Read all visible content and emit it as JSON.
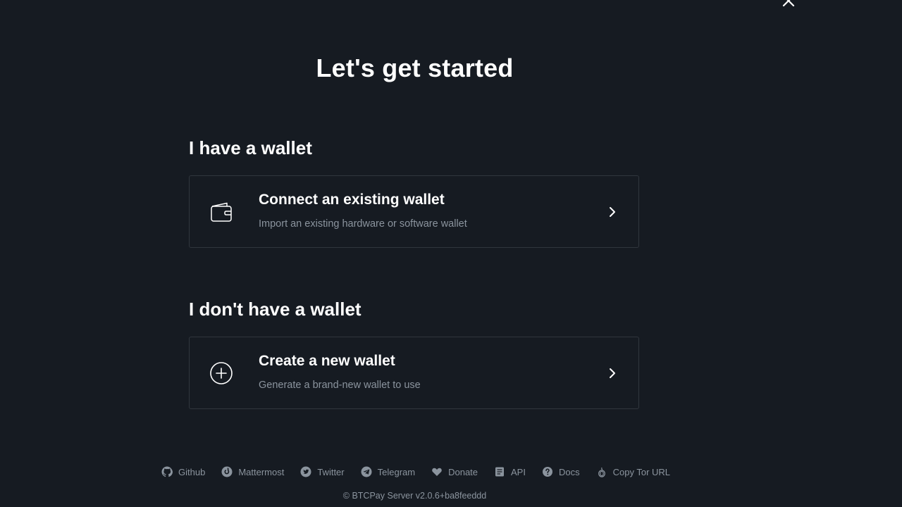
{
  "header": {
    "title": "Let's get started"
  },
  "sections": [
    {
      "heading": "I have a wallet",
      "card": {
        "icon": "wallet-icon",
        "title": "Connect an existing wallet",
        "subtitle": "Import an existing hardware or software wallet"
      }
    },
    {
      "heading": "I don't have a wallet",
      "card": {
        "icon": "plus-circle-icon",
        "title": "Create a new wallet",
        "subtitle": "Generate a brand-new wallet to use"
      }
    }
  ],
  "footer": {
    "links": [
      {
        "label": "Github",
        "icon": "github-icon"
      },
      {
        "label": "Mattermost",
        "icon": "mattermost-icon"
      },
      {
        "label": "Twitter",
        "icon": "twitter-icon"
      },
      {
        "label": "Telegram",
        "icon": "telegram-icon"
      },
      {
        "label": "Donate",
        "icon": "heart-icon"
      },
      {
        "label": "API",
        "icon": "api-doc-icon"
      },
      {
        "label": "Docs",
        "icon": "question-circle-icon"
      },
      {
        "label": "Copy Tor URL",
        "icon": "tor-onion-icon"
      }
    ],
    "copyright": "© BTCPay Server v2.0.6+ba8feeddd"
  },
  "colors": {
    "background": "#161b22",
    "text": "#ffffff",
    "muted": "#8b949e",
    "card_border": "#30363d"
  }
}
